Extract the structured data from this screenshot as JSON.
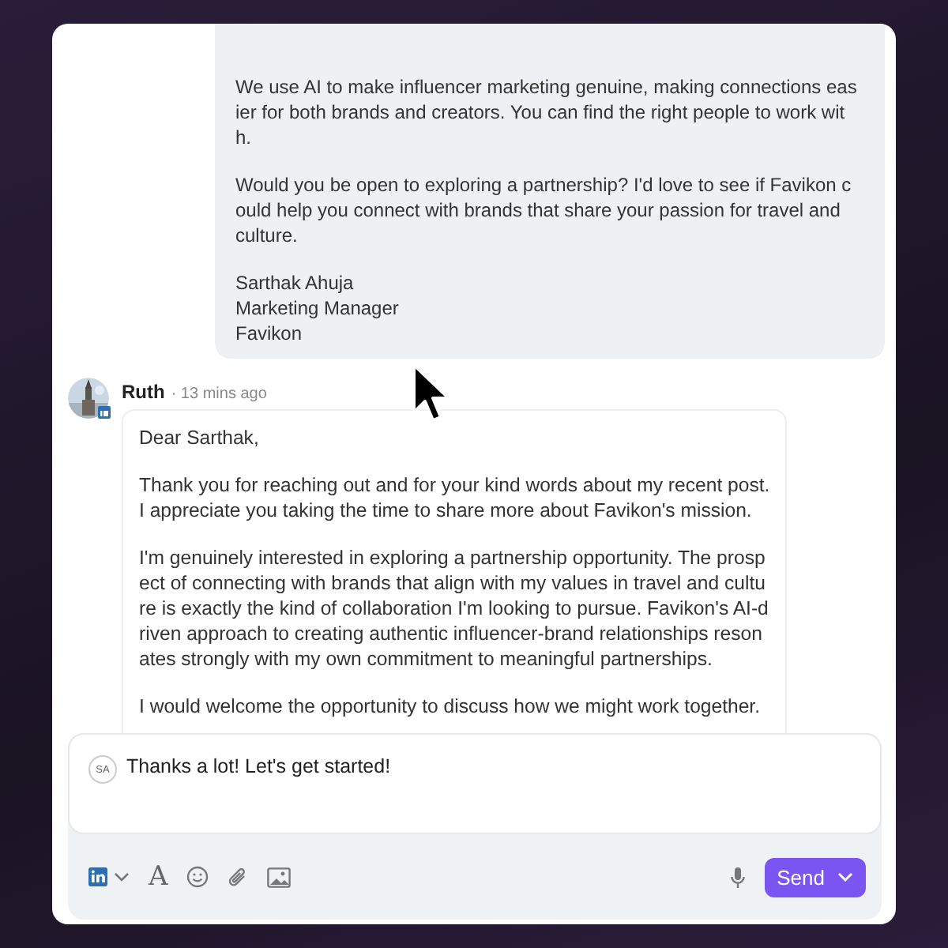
{
  "outgoing_message": {
    "paragraphs": [
      {
        "lines": [
          "We use AI to make influencer marketing genuine, making connections eas",
          "ier for both brands and creators. You can find the right people to work wit",
          "h."
        ]
      },
      {
        "lines": [
          "Would you be open to exploring a partnership? I'd love to see if Favikon c",
          "ould help you connect with brands that share your passion for travel and",
          "culture."
        ]
      },
      {
        "lines": [
          "Sarthak Ahuja",
          "Marketing Manager",
          "Favikon"
        ]
      }
    ]
  },
  "incoming_message": {
    "sender": "Ruth",
    "time": "· 13 mins ago",
    "paragraphs": [
      {
        "lines": [
          "Dear Sarthak,"
        ]
      },
      {
        "lines": [
          "Thank you for reaching out and for your kind words about my recent post.",
          "I appreciate you taking the time to share more about Favikon's mission."
        ]
      },
      {
        "lines": [
          "I'm genuinely interested in exploring a partnership opportunity. The prosp",
          "ect of connecting with brands that align with my values in travel and cultu",
          "re is exactly the kind of collaboration I'm looking to pursue. Favikon's AI-d",
          "riven approach to creating authentic influencer-brand relationships reson",
          "ates strongly with my own commitment to meaningful partnerships."
        ]
      },
      {
        "lines": [
          "I would welcome the opportunity to discuss how we might work together."
        ]
      }
    ]
  },
  "composer": {
    "avatar_initials": "SA",
    "value": "Thanks a lot! Let's get started!",
    "text_format_glyph": "A",
    "send_label": "Send"
  }
}
